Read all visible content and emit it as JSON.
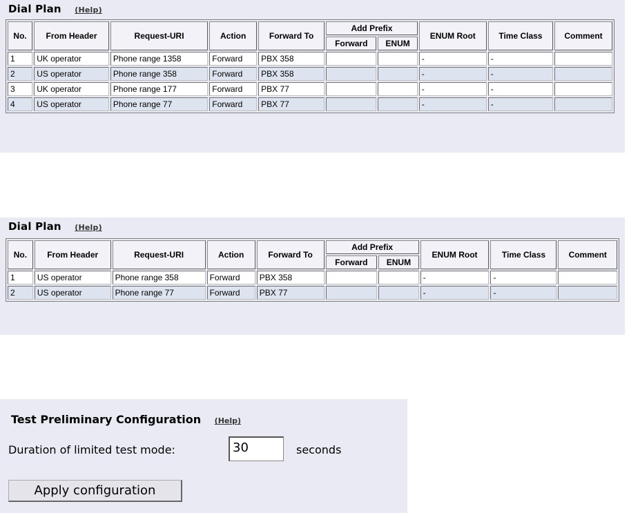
{
  "dial_plan_1": {
    "title": "Dial Plan",
    "help": "(Help)",
    "headers": {
      "no": "No.",
      "from_header": "From Header",
      "request_uri": "Request-URI",
      "action": "Action",
      "forward_to": "Forward To",
      "add_prefix": "Add Prefix",
      "prefix_forward": "Forward",
      "prefix_enum": "ENUM",
      "enum_root": "ENUM Root",
      "time_class": "Time Class",
      "comment": "Comment"
    },
    "rows": [
      {
        "no": "1",
        "from_header": "UK operator",
        "request_uri": "Phone range 1358",
        "action": "Forward",
        "forward_to": "PBX 358",
        "prefix_forward": "",
        "prefix_enum": "",
        "enum_root": "-",
        "time_class": "-",
        "comment": ""
      },
      {
        "no": "2",
        "from_header": "US operator",
        "request_uri": "Phone range 358",
        "action": "Forward",
        "forward_to": "PBX 358",
        "prefix_forward": "",
        "prefix_enum": "",
        "enum_root": "-",
        "time_class": "-",
        "comment": ""
      },
      {
        "no": "3",
        "from_header": "UK operator",
        "request_uri": "Phone range 177",
        "action": "Forward",
        "forward_to": "PBX 77",
        "prefix_forward": "",
        "prefix_enum": "",
        "enum_root": "-",
        "time_class": "-",
        "comment": ""
      },
      {
        "no": "4",
        "from_header": "US operator",
        "request_uri": "Phone range 77",
        "action": "Forward",
        "forward_to": "PBX 77",
        "prefix_forward": "",
        "prefix_enum": "",
        "enum_root": "-",
        "time_class": "-",
        "comment": ""
      }
    ]
  },
  "dial_plan_2": {
    "title": "Dial Plan",
    "help": "(Help)",
    "headers": {
      "no": "No.",
      "from_header": "From Header",
      "request_uri": "Request-URI",
      "action": "Action",
      "forward_to": "Forward To",
      "add_prefix": "Add Prefix",
      "prefix_forward": "Forward",
      "prefix_enum": "ENUM",
      "enum_root": "ENUM Root",
      "time_class": "Time Class",
      "comment": "Comment"
    },
    "rows": [
      {
        "no": "1",
        "from_header": "US operator",
        "request_uri": "Phone range 358",
        "action": "Forward",
        "forward_to": "PBX 358",
        "prefix_forward": "",
        "prefix_enum": "",
        "enum_root": "-",
        "time_class": "-",
        "comment": ""
      },
      {
        "no": "2",
        "from_header": "US operator",
        "request_uri": "Phone range 77",
        "action": "Forward",
        "forward_to": "PBX 77",
        "prefix_forward": "",
        "prefix_enum": "",
        "enum_root": "-",
        "time_class": "-",
        "comment": ""
      }
    ]
  },
  "test_config": {
    "title": "Test Preliminary Configuration",
    "help": "(Help)",
    "duration_label": "Duration of limited test mode:",
    "duration_value": "30",
    "seconds_label": "seconds",
    "apply_label": "Apply configuration"
  }
}
